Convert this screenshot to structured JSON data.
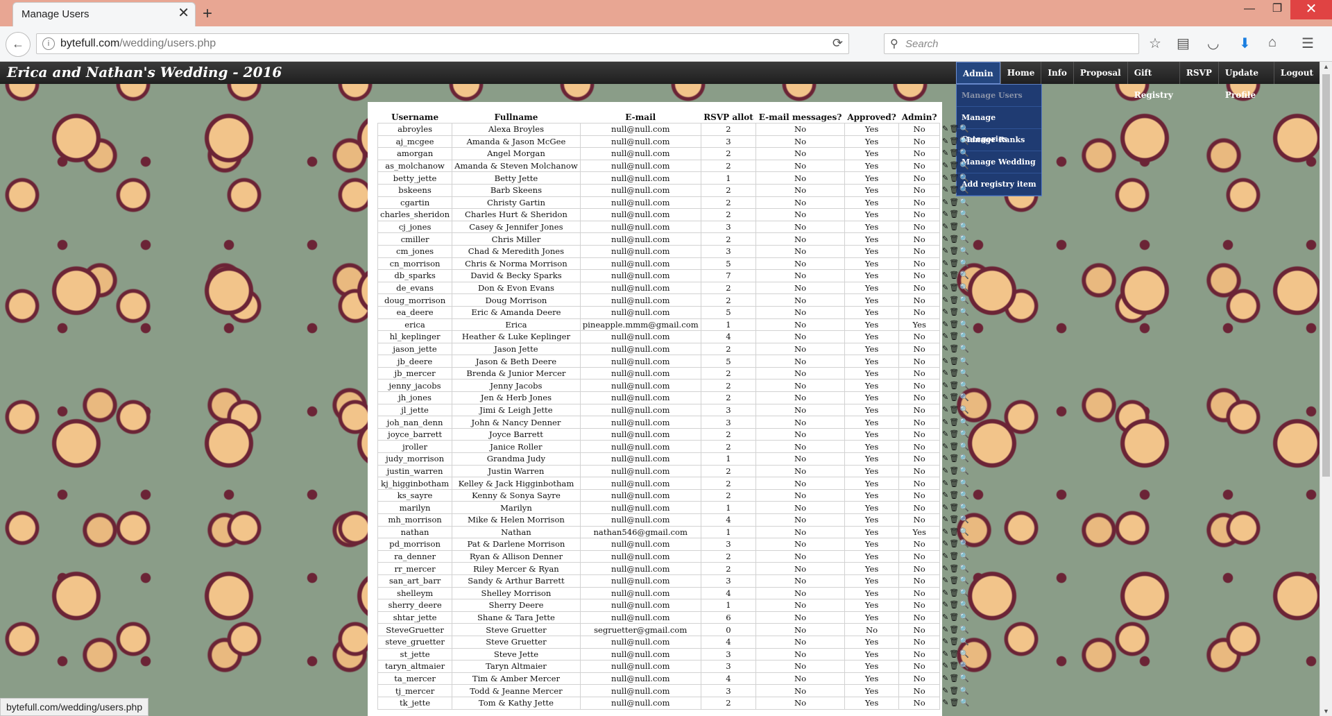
{
  "browser": {
    "tab_title": "Manage Users",
    "tab_close": "✕",
    "new_tab": "+",
    "url_host": "bytefull.com",
    "url_path": "/wedding/users.php",
    "search_placeholder": "Search",
    "status_url": "bytefull.com/wedding/users.php"
  },
  "site": {
    "title": "Erica and Nathan's Wedding - 2016"
  },
  "menu": [
    {
      "label": "Admin",
      "name": "menu-admin"
    },
    {
      "label": "Home",
      "name": "menu-home"
    },
    {
      "label": "Info",
      "name": "menu-info"
    },
    {
      "label": "Proposal",
      "name": "menu-proposal"
    },
    {
      "label": "Gift Registry",
      "name": "menu-gift-registry"
    },
    {
      "label": "RSVP",
      "name": "menu-rsvp"
    },
    {
      "label": "Update Profile",
      "name": "menu-update-profile"
    },
    {
      "label": "Logout",
      "name": "menu-logout"
    }
  ],
  "admin_dropdown": [
    "Manage Users",
    "Manage Categories",
    "Manage Ranks",
    "Manage Wedding",
    "Add registry item"
  ],
  "table": {
    "headers": [
      "Username",
      "Fullname",
      "E-mail",
      "RSVP allot",
      "E-mail messages?",
      "Approved?",
      "Admin?",
      ""
    ],
    "actions_icons": [
      "edit-icon",
      "delete-icon",
      "view-icon"
    ],
    "rows": [
      [
        "abroyles",
        "Alexa Broyles",
        "null@null.com",
        "2",
        "No",
        "Yes",
        "No"
      ],
      [
        "aj_mcgee",
        "Amanda & Jason McGee",
        "null@null.com",
        "3",
        "No",
        "Yes",
        "No"
      ],
      [
        "amorgan",
        "Angel Morgan",
        "null@null.com",
        "2",
        "No",
        "Yes",
        "No"
      ],
      [
        "as_molchanow",
        "Amanda & Steven Molchanow",
        "null@null.com",
        "2",
        "No",
        "Yes",
        "No"
      ],
      [
        "betty_jette",
        "Betty Jette",
        "null@null.com",
        "1",
        "No",
        "Yes",
        "No"
      ],
      [
        "bskeens",
        "Barb Skeens",
        "null@null.com",
        "2",
        "No",
        "Yes",
        "No"
      ],
      [
        "cgartin",
        "Christy Gartin",
        "null@null.com",
        "2",
        "No",
        "Yes",
        "No"
      ],
      [
        "charles_sheridon",
        "Charles Hurt & Sheridon",
        "null@null.com",
        "2",
        "No",
        "Yes",
        "No"
      ],
      [
        "cj_jones",
        "Casey & Jennifer Jones",
        "null@null.com",
        "3",
        "No",
        "Yes",
        "No"
      ],
      [
        "cmiller",
        "Chris Miller",
        "null@null.com",
        "2",
        "No",
        "Yes",
        "No"
      ],
      [
        "cm_jones",
        "Chad & Meredith Jones",
        "null@null.com",
        "3",
        "No",
        "Yes",
        "No"
      ],
      [
        "cn_morrison",
        "Chris & Norma Morrison",
        "null@null.com",
        "5",
        "No",
        "Yes",
        "No"
      ],
      [
        "db_sparks",
        "David & Becky Sparks",
        "null@null.com",
        "7",
        "No",
        "Yes",
        "No"
      ],
      [
        "de_evans",
        "Don & Evon Evans",
        "null@null.com",
        "2",
        "No",
        "Yes",
        "No"
      ],
      [
        "doug_morrison",
        "Doug Morrison",
        "null@null.com",
        "2",
        "No",
        "Yes",
        "No"
      ],
      [
        "ea_deere",
        "Eric & Amanda Deere",
        "null@null.com",
        "5",
        "No",
        "Yes",
        "No"
      ],
      [
        "erica",
        "Erica",
        "pineapple.mmm@gmail.com",
        "1",
        "No",
        "Yes",
        "Yes"
      ],
      [
        "hl_keplinger",
        "Heather & Luke Keplinger",
        "null@null.com",
        "4",
        "No",
        "Yes",
        "No"
      ],
      [
        "jason_jette",
        "Jason Jette",
        "null@null.com",
        "2",
        "No",
        "Yes",
        "No"
      ],
      [
        "jb_deere",
        "Jason & Beth Deere",
        "null@null.com",
        "5",
        "No",
        "Yes",
        "No"
      ],
      [
        "jb_mercer",
        "Brenda & Junior Mercer",
        "null@null.com",
        "2",
        "No",
        "Yes",
        "No"
      ],
      [
        "jenny_jacobs",
        "Jenny Jacobs",
        "null@null.com",
        "2",
        "No",
        "Yes",
        "No"
      ],
      [
        "jh_jones",
        "Jen & Herb Jones",
        "null@null.com",
        "2",
        "No",
        "Yes",
        "No"
      ],
      [
        "jl_jette",
        "Jimi & Leigh Jette",
        "null@null.com",
        "3",
        "No",
        "Yes",
        "No"
      ],
      [
        "joh_nan_denn",
        "John & Nancy Denner",
        "null@null.com",
        "3",
        "No",
        "Yes",
        "No"
      ],
      [
        "joyce_barrett",
        "Joyce Barrett",
        "null@null.com",
        "2",
        "No",
        "Yes",
        "No"
      ],
      [
        "jroller",
        "Janice Roller",
        "null@null.com",
        "2",
        "No",
        "Yes",
        "No"
      ],
      [
        "judy_morrison",
        "Grandma Judy",
        "null@null.com",
        "1",
        "No",
        "Yes",
        "No"
      ],
      [
        "justin_warren",
        "Justin Warren",
        "null@null.com",
        "2",
        "No",
        "Yes",
        "No"
      ],
      [
        "kj_higginbotham",
        "Kelley & Jack Higginbotham",
        "null@null.com",
        "2",
        "No",
        "Yes",
        "No"
      ],
      [
        "ks_sayre",
        "Kenny & Sonya Sayre",
        "null@null.com",
        "2",
        "No",
        "Yes",
        "No"
      ],
      [
        "marilyn",
        "Marilyn",
        "null@null.com",
        "1",
        "No",
        "Yes",
        "No"
      ],
      [
        "mh_morrison",
        "Mike & Helen Morrison",
        "null@null.com",
        "4",
        "No",
        "Yes",
        "No"
      ],
      [
        "nathan",
        "Nathan",
        "nathan546@gmail.com",
        "1",
        "No",
        "Yes",
        "Yes"
      ],
      [
        "pd_morrison",
        "Pat & Darlene Morrison",
        "null@null.com",
        "3",
        "No",
        "Yes",
        "No"
      ],
      [
        "ra_denner",
        "Ryan & Allison Denner",
        "null@null.com",
        "2",
        "No",
        "Yes",
        "No"
      ],
      [
        "rr_mercer",
        "Riley Mercer & Ryan",
        "null@null.com",
        "2",
        "No",
        "Yes",
        "No"
      ],
      [
        "san_art_barr",
        "Sandy & Arthur Barrett",
        "null@null.com",
        "3",
        "No",
        "Yes",
        "No"
      ],
      [
        "shelleym",
        "Shelley Morrison",
        "null@null.com",
        "4",
        "No",
        "Yes",
        "No"
      ],
      [
        "sherry_deere",
        "Sherry Deere",
        "null@null.com",
        "1",
        "No",
        "Yes",
        "No"
      ],
      [
        "shtar_jette",
        "Shane & Tara Jette",
        "null@null.com",
        "6",
        "No",
        "Yes",
        "No"
      ],
      [
        "SteveGruetter",
        "Steve Gruetter",
        "segruetter@gmail.com",
        "0",
        "No",
        "No",
        "No"
      ],
      [
        "steve_gruetter",
        "Steve Gruetter",
        "null@null.com",
        "4",
        "No",
        "Yes",
        "No"
      ],
      [
        "st_jette",
        "Steve Jette",
        "null@null.com",
        "3",
        "No",
        "Yes",
        "No"
      ],
      [
        "taryn_altmaier",
        "Taryn Altmaier",
        "null@null.com",
        "3",
        "No",
        "Yes",
        "No"
      ],
      [
        "ta_mercer",
        "Tim & Amber Mercer",
        "null@null.com",
        "4",
        "No",
        "Yes",
        "No"
      ],
      [
        "tj_mercer",
        "Todd & Jeanne Mercer",
        "null@null.com",
        "3",
        "No",
        "Yes",
        "No"
      ],
      [
        "tk_jette",
        "Tom & Kathy Jette",
        "null@null.com",
        "2",
        "No",
        "Yes",
        "No"
      ]
    ]
  }
}
